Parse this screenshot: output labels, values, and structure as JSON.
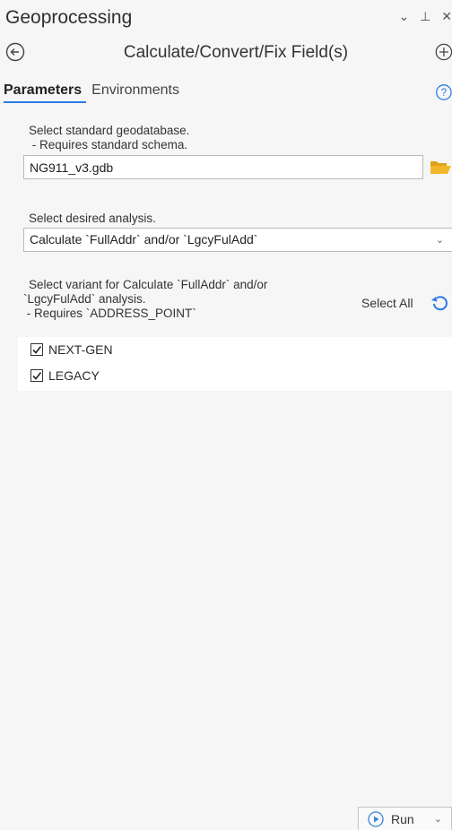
{
  "pane": {
    "title": "Geoprocessing",
    "ctrl_dropdown": "⌄",
    "ctrl_pin": "⊥",
    "ctrl_close": "✕"
  },
  "tool": {
    "title": "Calculate/Convert/Fix Field(s)"
  },
  "tabs": [
    {
      "label": "Parameters",
      "active": true
    },
    {
      "label": "Environments",
      "active": false
    }
  ],
  "params": {
    "gdb_label_1": "Select standard geodatabase.",
    "gdb_label_2": " - Requires standard schema.",
    "gdb_value": "NG911_v3.gdb",
    "analysis_label": "Select desired analysis.",
    "analysis_value": "Calculate `FullAddr` and/or `LgcyFulAdd`",
    "variant_label_1": "Select variant for Calculate `FullAddr` and/or",
    "variant_label_2": "`LgcyFulAdd` analysis.",
    "variant_label_3": " - Requires `ADDRESS_POINT`",
    "select_all": "Select All",
    "options": [
      {
        "label": "NEXT-GEN",
        "checked": true
      },
      {
        "label": "LEGACY",
        "checked": true
      }
    ]
  },
  "footer": {
    "run_label": "Run"
  },
  "colors": {
    "accent": "#2c7be5",
    "folder": "#f2b728",
    "run_icon": "#3a84d8"
  }
}
